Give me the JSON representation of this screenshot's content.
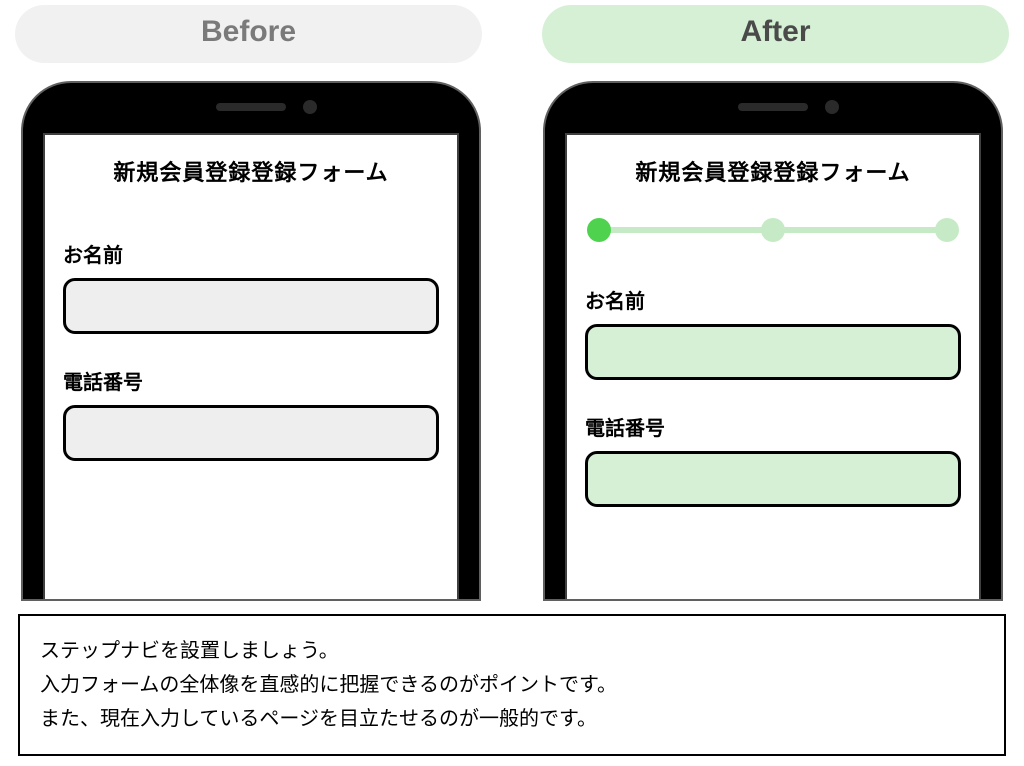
{
  "badges": {
    "before": "Before",
    "after": "After"
  },
  "before_form": {
    "title": "新規会員登録登録フォーム",
    "fields": {
      "name_label": "お名前",
      "name_value": "",
      "phone_label": "電話番号",
      "phone_value": ""
    }
  },
  "after_form": {
    "title": "新規会員登録登録フォーム",
    "step_nav": {
      "total": 3,
      "active_index": 0
    },
    "fields": {
      "name_label": "お名前",
      "name_value": "",
      "phone_label": "電話番号",
      "phone_value": ""
    }
  },
  "caption": {
    "line1": "ステップナビを設置しましょう。",
    "line2": "入力フォームの全体像を直感的に把握できるのがポイントです。",
    "line3": "また、現在入力しているページを目立たせるのが一般的です。"
  },
  "colors": {
    "accent_green": "#4fd34f",
    "light_green": "#d6f0d6",
    "step_inactive": "#c6eac6",
    "badge_gray": "#f1f1f1"
  }
}
